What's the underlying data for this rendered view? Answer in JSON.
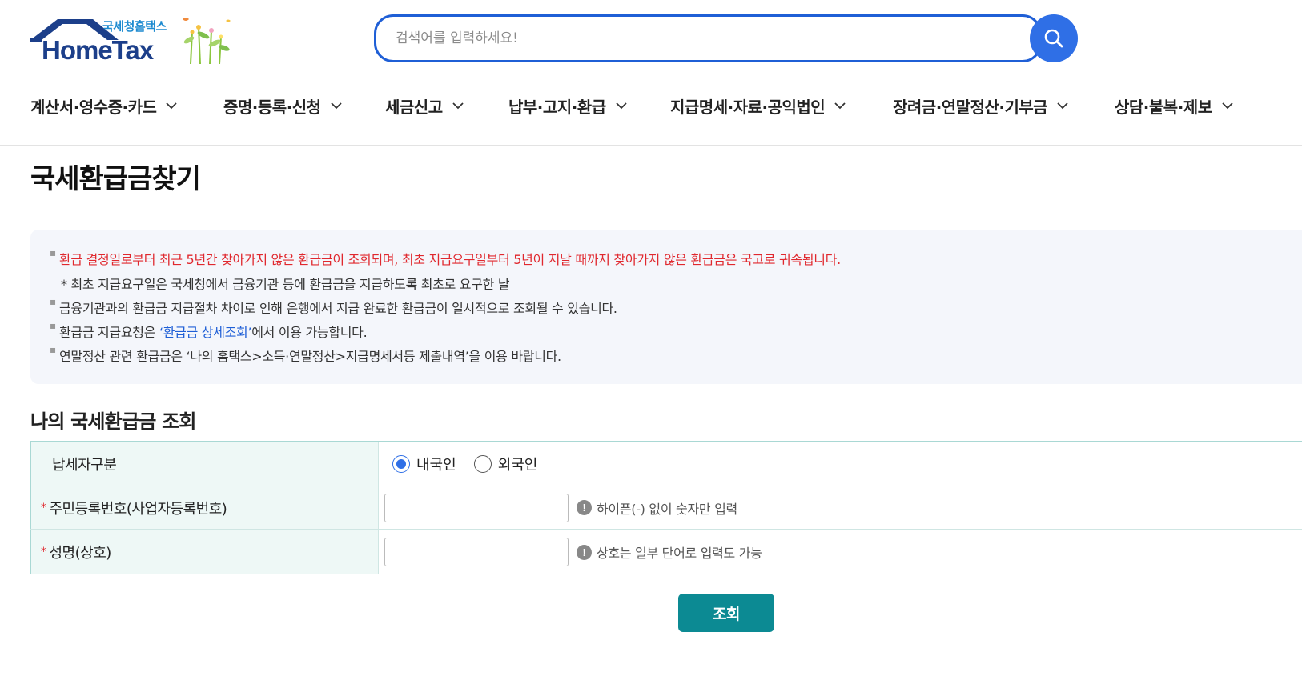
{
  "header": {
    "logo_sub": "국세청홈택스",
    "logo_main": "HomeTax",
    "search_placeholder": "검색어를 입력하세요!",
    "nav": [
      {
        "label": "계산서·영수증·카드"
      },
      {
        "label": "증명·등록·신청"
      },
      {
        "label": "세금신고"
      },
      {
        "label": "납부·고지·환급"
      },
      {
        "label": "지급명세·자료·공익법인"
      },
      {
        "label": "장려금·연말정산·기부금"
      },
      {
        "label": "상담·불복·제보"
      }
    ]
  },
  "page": {
    "title": "국세환급금찾기"
  },
  "info": {
    "line1": "환급 결정일로부터 최근 5년간 찾아가지 않은 환급금이 조회되며, 최초 지급요구일부터 5년이 지날 때까지 찾아가지 않은 환급금은 국고로 귀속됩니다.",
    "line1_note": "* 최초 지급요구일은 국세청에서 금융기관 등에 환급금을 지급하도록 최초로 요구한 날",
    "line2": "금융기관과의 환급금 지급절차 차이로 인해 은행에서 지급 완료한 환급금이 일시적으로 조회될 수 있습니다.",
    "line3_prefix": "환급금 지급요청은 ",
    "line3_link": "‘환급금 상세조회’",
    "line3_suffix": "에서 이용 가능합니다.",
    "line4": "연말정산 관련 환급금은 ‘나의 홈택스>소득·연말정산>지급명세서등 제출내역’을 이용 바랍니다."
  },
  "form": {
    "section_title": "나의 국세환급금 조회",
    "taxpayer_type_label": "납세자구분",
    "option_domestic": "내국인",
    "option_foreign": "외국인",
    "selected_option": "내국인",
    "required_mark": "*",
    "id_label": "주민등록번호(사업자등록번호)",
    "id_value": "",
    "id_hint": "하이픈(-) 없이 숫자만 입력",
    "name_label": "성명(상호)",
    "name_value": "",
    "name_hint": "상호는 일부 단어로 입력도 가능",
    "hint_icon": "!",
    "submit_label": "조회"
  },
  "colors": {
    "brand_blue": "#1f5fd6",
    "notice_red": "#e0282e",
    "table_header_bg": "#eef8f6",
    "submit_teal": "#0c8a93"
  }
}
